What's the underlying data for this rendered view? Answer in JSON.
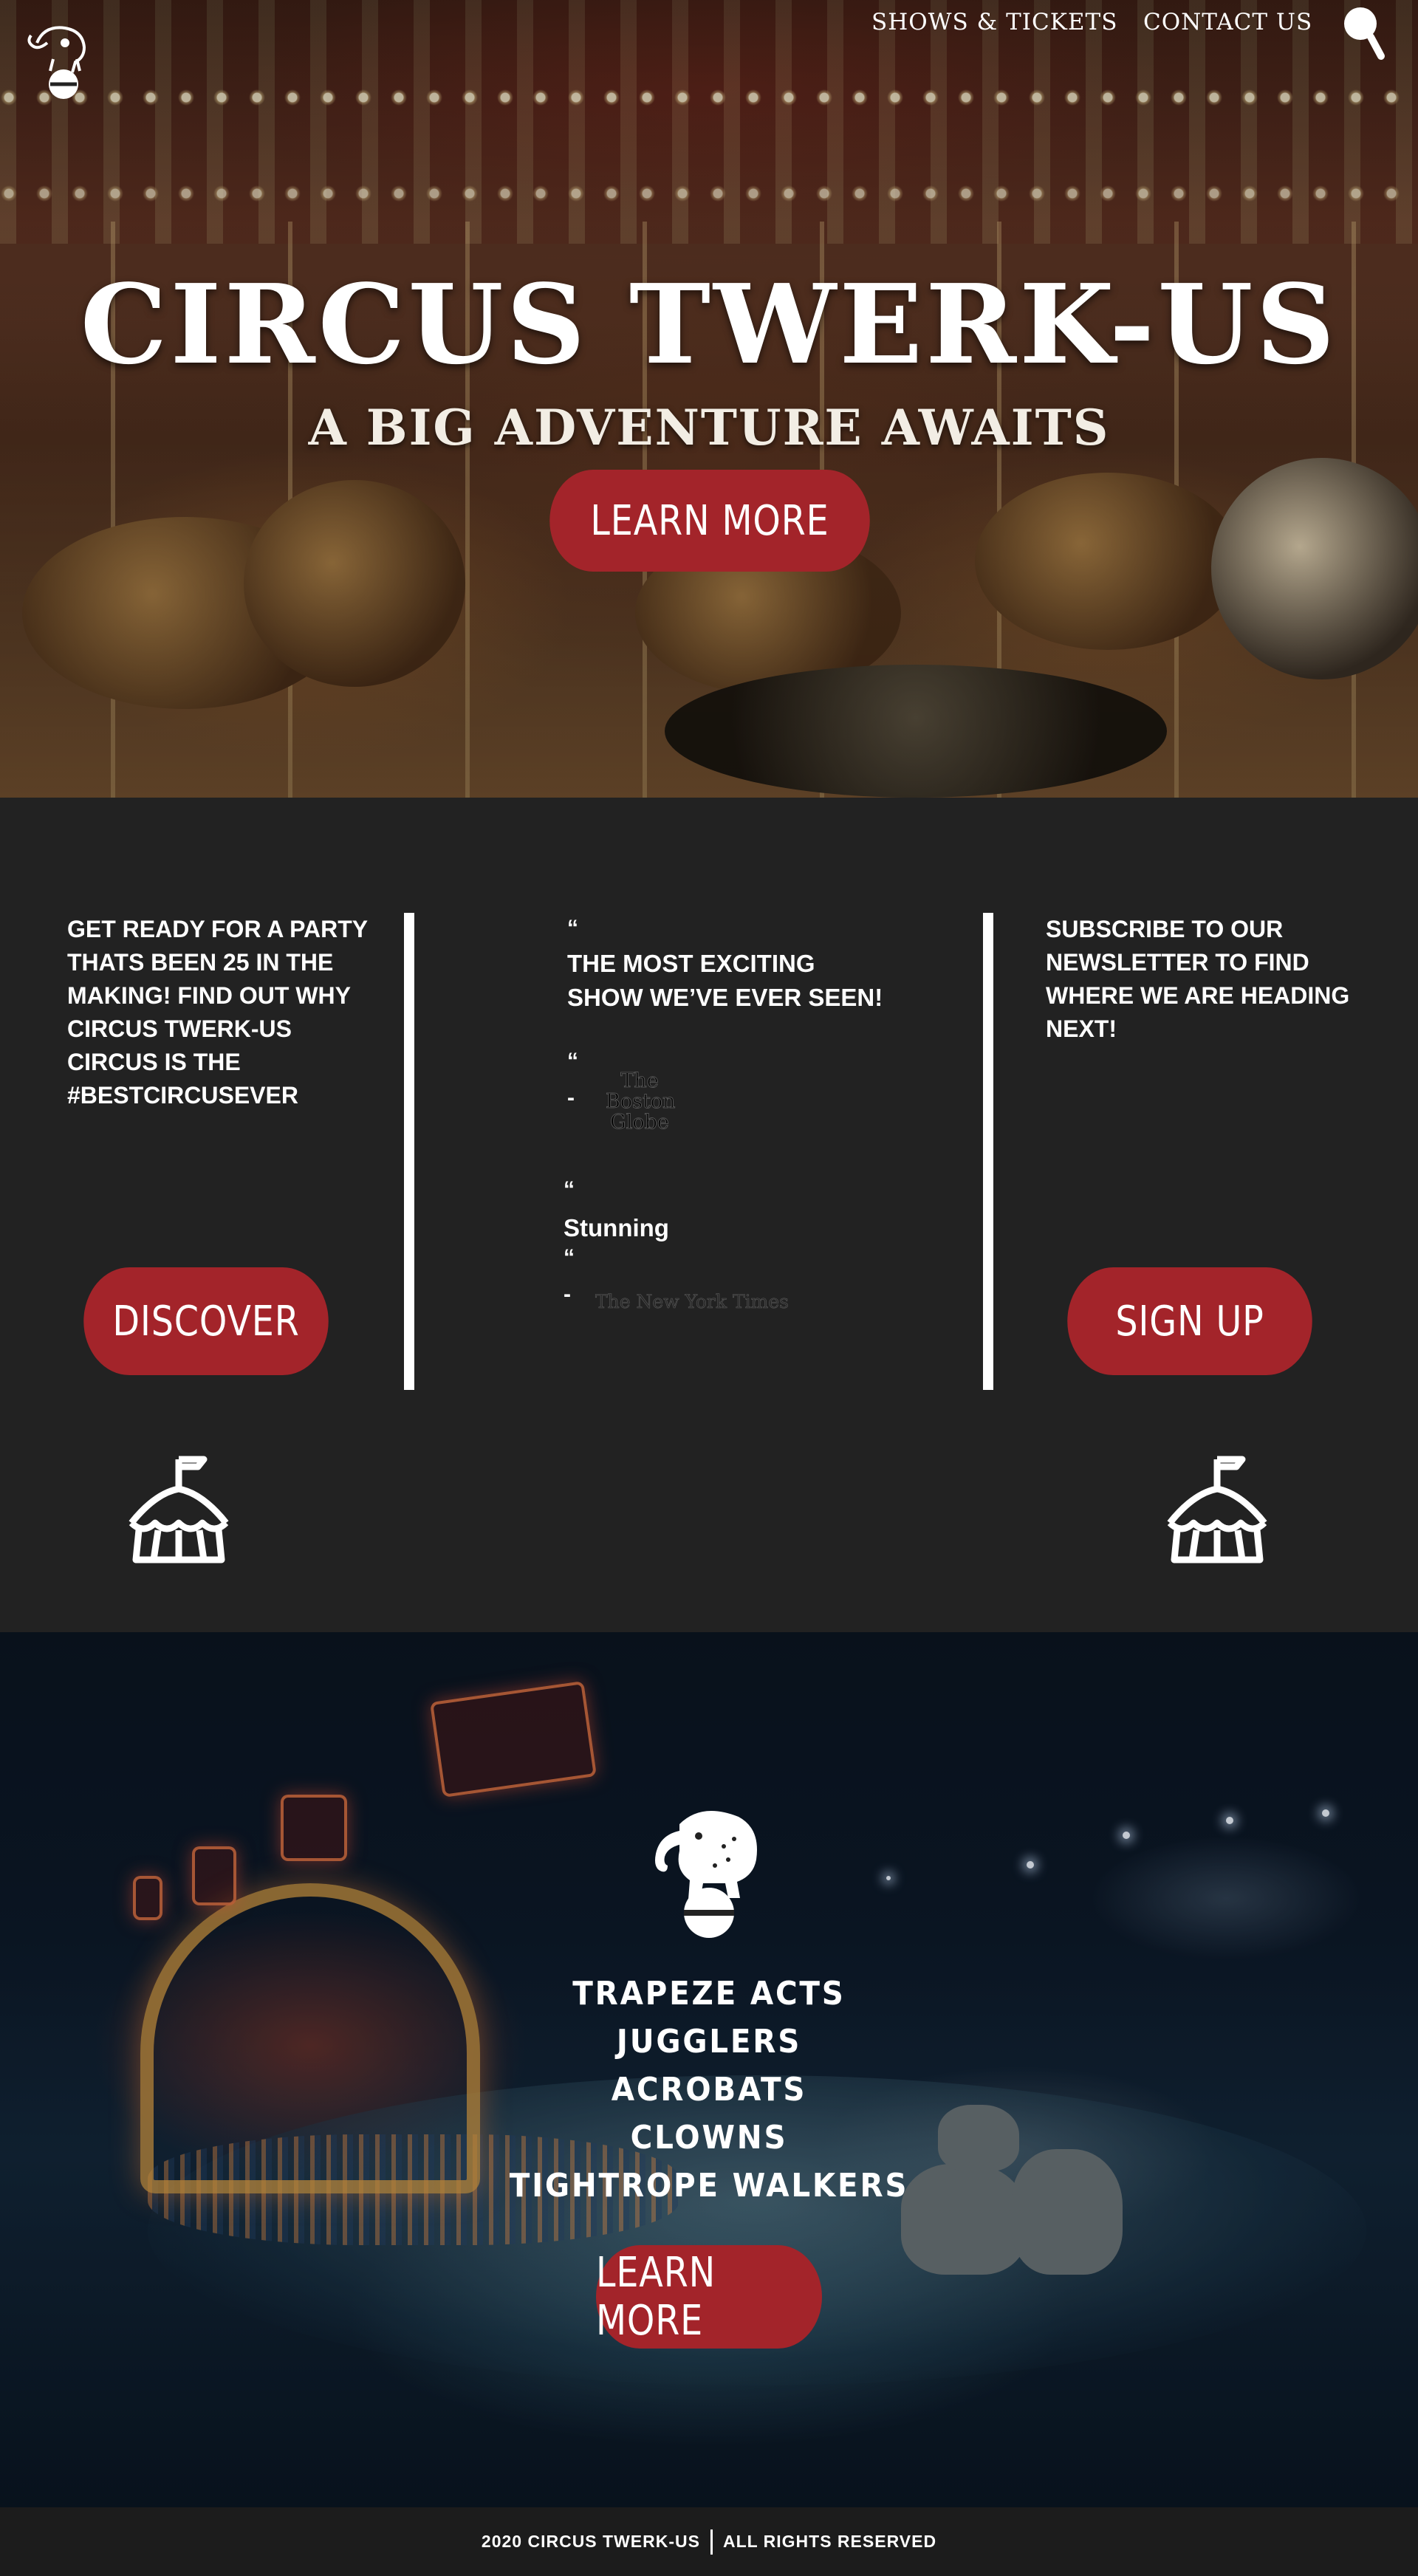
{
  "nav": {
    "shows_tickets": "SHOWS & TICKETS",
    "contact_us": "CONTACT US"
  },
  "hero": {
    "title": "CIRCUS TWERK-US",
    "subtitle": "A BIG ADVENTURE AWAITS",
    "button": "LEARN MORE"
  },
  "left_column": {
    "text": "GET READY FOR A PARTY THATS BEEN 25 IN THE MAKING! FIND OUT WHY CIRCUS TWERK-US CIRCUS IS THE #BESTCIRCUSEVER",
    "button": "DISCOVER"
  },
  "reviews": [
    {
      "open_quote": "“",
      "quote": "THE MOST EXCITING SHOW WE’VE EVER SEEN!",
      "close_quote": "“",
      "dash": "-",
      "source": "The Boston Globe"
    },
    {
      "open_quote": "“",
      "quote": "Stunning",
      "close_quote": "“",
      "dash": "-",
      "source": "The New York Times"
    }
  ],
  "right_column": {
    "text": "SUBSCRIBE TO OUR NEWSLETTER TO FIND WHERE WE ARE HEADING NEXT!",
    "button": "SIGN UP"
  },
  "acts": {
    "items": [
      "TRAPEZE ACTS",
      "JUGGLERS",
      "ACROBATS",
      "CLOWNS",
      "TIGHTROPE WALKERS"
    ],
    "button": "LEARN MORE"
  },
  "footer": {
    "copyright": "2020 CIRCUS TWERK-US",
    "rights": "ALL RIGHTS RESERVED"
  },
  "colors": {
    "accent": "#a3242a",
    "dark_bg": "#222222",
    "footer_bg": "#1c1c1c",
    "text": "#ffffff"
  },
  "icons": [
    "elephant-on-ball-logo",
    "search-icon",
    "circus-tent-icon"
  ]
}
